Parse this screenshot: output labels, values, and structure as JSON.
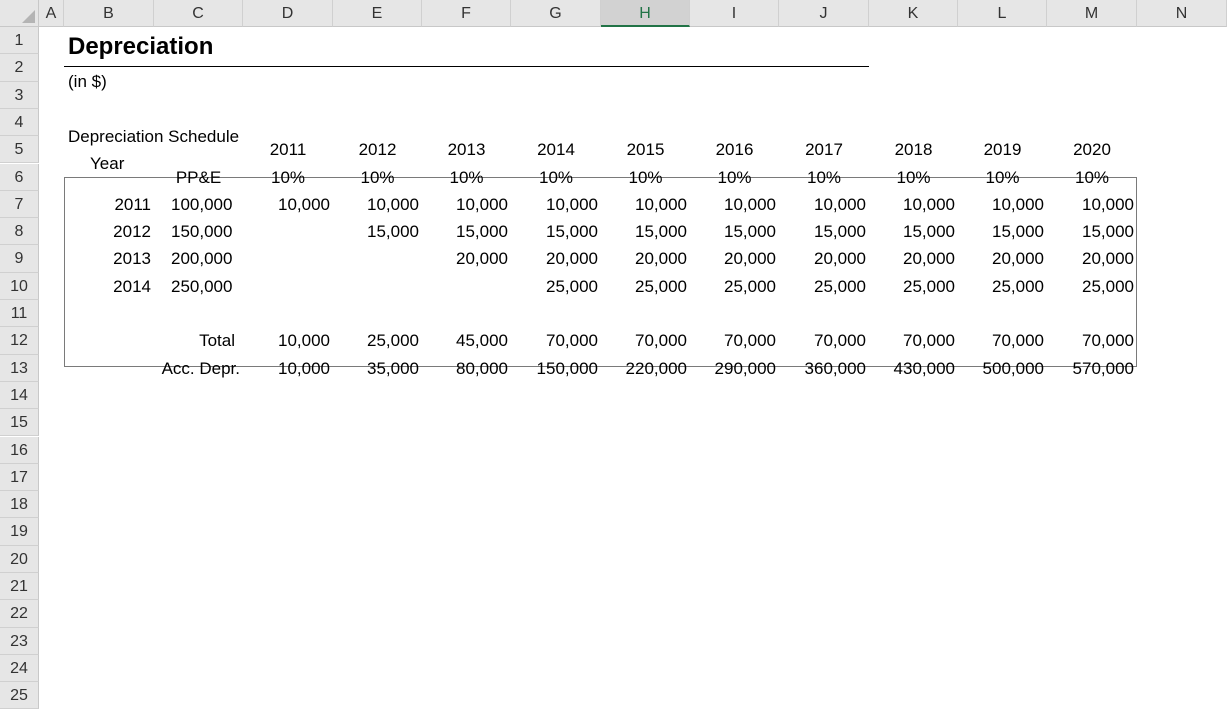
{
  "columns": [
    "A",
    "B",
    "C",
    "D",
    "E",
    "F",
    "G",
    "H",
    "I",
    "J",
    "K",
    "L",
    "M",
    "N"
  ],
  "selected_column": "H",
  "rows": [
    "1",
    "2",
    "3",
    "4",
    "5",
    "6",
    "7",
    "8",
    "9",
    "10",
    "11",
    "12",
    "13",
    "14",
    "15",
    "16",
    "17",
    "18",
    "19",
    "20",
    "21",
    "22",
    "23",
    "24",
    "25"
  ],
  "sheet": {
    "title": "Depreciation",
    "subtitle": "(in $)",
    "schedule_label": "Depreciation Schedule",
    "year_label": "Year",
    "ppe_label": "PP&E",
    "total_label": "Total",
    "acc_label": "Acc. Depr.",
    "years": [
      "2011",
      "2012",
      "2013",
      "2014",
      "2015",
      "2016",
      "2017",
      "2018",
      "2019",
      "2020"
    ],
    "rates": [
      "10%",
      "10%",
      "10%",
      "10%",
      "10%",
      "10%",
      "10%",
      "10%",
      "10%",
      "10%"
    ],
    "assets": [
      {
        "year": "2011",
        "ppe": "100,000",
        "values": [
          "10,000",
          "10,000",
          "10,000",
          "10,000",
          "10,000",
          "10,000",
          "10,000",
          "10,000",
          "10,000",
          "10,000"
        ]
      },
      {
        "year": "2012",
        "ppe": "150,000",
        "values": [
          "",
          "15,000",
          "15,000",
          "15,000",
          "15,000",
          "15,000",
          "15,000",
          "15,000",
          "15,000",
          "15,000"
        ]
      },
      {
        "year": "2013",
        "ppe": "200,000",
        "values": [
          "",
          "",
          "20,000",
          "20,000",
          "20,000",
          "20,000",
          "20,000",
          "20,000",
          "20,000",
          "20,000"
        ]
      },
      {
        "year": "2014",
        "ppe": "250,000",
        "values": [
          "",
          "",
          "",
          "25,000",
          "25,000",
          "25,000",
          "25,000",
          "25,000",
          "25,000",
          "25,000"
        ]
      }
    ],
    "totals": [
      "10,000",
      "25,000",
      "45,000",
      "70,000",
      "70,000",
      "70,000",
      "70,000",
      "70,000",
      "70,000",
      "70,000"
    ],
    "accumulated": [
      "10,000",
      "35,000",
      "80,000",
      "150,000",
      "220,000",
      "290,000",
      "360,000",
      "430,000",
      "500,000",
      "570,000"
    ]
  }
}
